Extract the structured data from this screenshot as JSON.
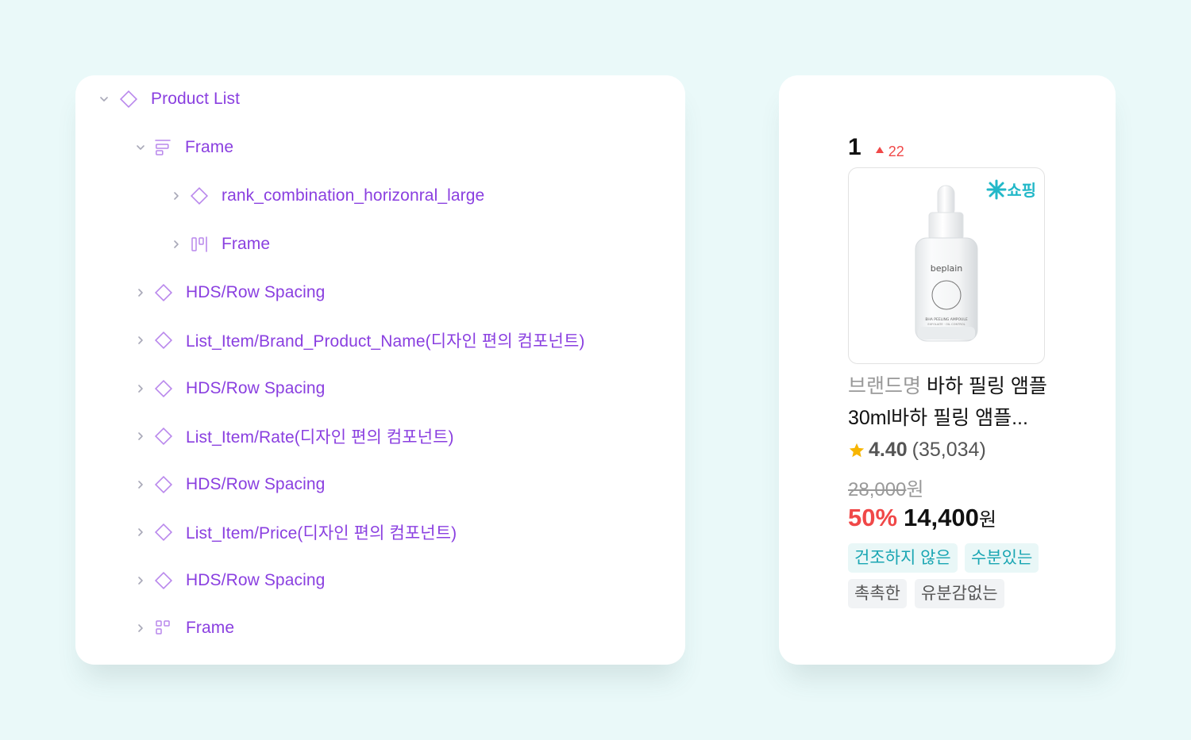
{
  "layers": {
    "items": [
      {
        "name": "Product List"
      },
      {
        "name": "Frame"
      },
      {
        "name": "rank_combination_horizonral_large"
      },
      {
        "name": "Frame"
      },
      {
        "name": "HDS/Row Spacing"
      },
      {
        "name": "List_Item/Brand_Product_Name(디자인 편의 컴포넌트)"
      },
      {
        "name": "HDS/Row Spacing"
      },
      {
        "name": "List_Item/Rate(디자인 편의 컴포넌트)"
      },
      {
        "name": "HDS/Row Spacing"
      },
      {
        "name": "List_Item/Price(디자인 편의 컴포넌트)"
      },
      {
        "name": "HDS/Row Spacing"
      },
      {
        "name": "Frame"
      }
    ]
  },
  "product": {
    "rank": "1",
    "rank_change": "22",
    "badge_label": "쇼핑",
    "bottle_brand": "beplain",
    "bottle_label_1": "BHA PEELING AMPOULE",
    "bottle_label_2": "EXFOLIATE · OIL CONTROL",
    "brand": "브랜드명",
    "name": "바하 필링 앰플",
    "name_line2": "30ml바하 필링 앰플...",
    "rating": "4.40",
    "review_count": "(35,034)",
    "original_price": "28,000",
    "currency": "원",
    "discount": "50%",
    "sale_price": "14,400",
    "tags": [
      "건조하지 않은",
      "수분있는",
      "촉촉한",
      "유분감없는"
    ]
  },
  "colors": {
    "page_bg": "#eaf9f9",
    "layer_text": "#8a3fe0",
    "accent_red": "#f04848",
    "accent_teal": "#1aa6b3",
    "star": "#f7b500"
  }
}
